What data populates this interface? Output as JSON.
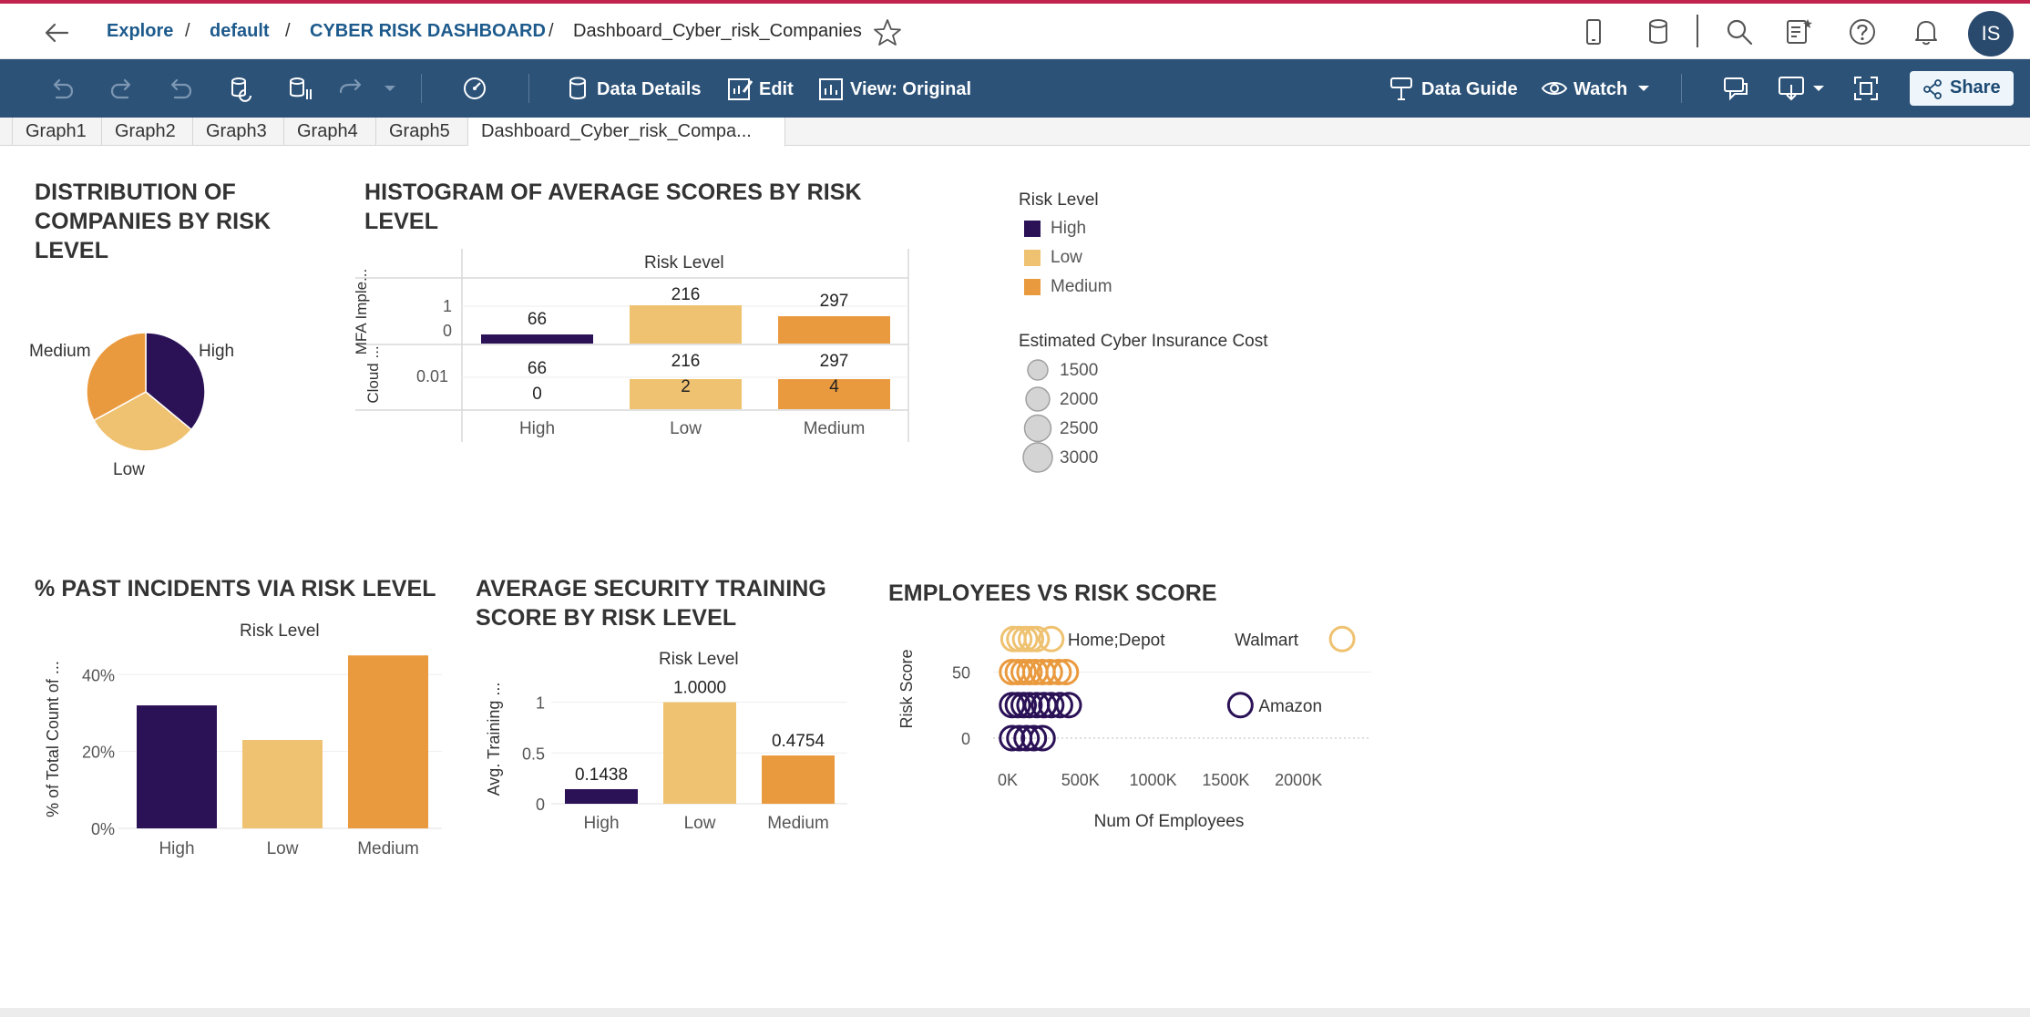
{
  "breadcrumb": {
    "explore": "Explore",
    "project": "default",
    "workbook": "CYBER RISK DASHBOARD",
    "view": "Dashboard_Cyber_risk_Companies",
    "sep": "/"
  },
  "user": {
    "initials": "IS"
  },
  "toolbar": {
    "data_details": "Data Details",
    "edit": "Edit",
    "view_original": "View: Original",
    "data_guide": "Data Guide",
    "watch": "Watch",
    "share": "Share"
  },
  "tabs": [
    "Graph1",
    "Graph2",
    "Graph3",
    "Graph4",
    "Graph5",
    "Dashboard_Cyber_risk_Compa..."
  ],
  "colors": {
    "high": "#2b1257",
    "low": "#efc271",
    "medium": "#ea9a3e",
    "toolbar": "#2c5278",
    "link": "#1d5a8c"
  },
  "pie": {
    "title": "DISTRIBUTION OF COMPANIES BY RISK LEVEL",
    "labels": {
      "medium": "Medium",
      "high": "High",
      "low": "Low"
    }
  },
  "histogram": {
    "title": "HISTOGRAM OF AVERAGE SCORES BY RISK LEVEL",
    "header": "Risk Level",
    "row1_label": "MFA Imple...",
    "row2_label": "Cloud ...",
    "row1_ticks": [
      "1",
      "0"
    ],
    "row2_tick": "0.01",
    "row1_values": [
      "66",
      "216",
      "297"
    ],
    "row2_top_values": [
      "66",
      "216",
      "297"
    ],
    "row2_bar_values": [
      "0",
      "2",
      "4"
    ],
    "categories": [
      "High",
      "Low",
      "Medium"
    ]
  },
  "legend": {
    "risk_title": "Risk Level",
    "risk_items": [
      "High",
      "Low",
      "Medium"
    ],
    "cost_title": "Estimated Cyber Insurance Cost",
    "cost_items": [
      "1500",
      "2000",
      "2500",
      "3000"
    ]
  },
  "chart_data": [
    {
      "type": "pie",
      "title": "DISTRIBUTION OF COMPANIES BY RISK LEVEL",
      "categories": [
        "High",
        "Low",
        "Medium"
      ],
      "values": [
        0.36,
        0.31,
        0.33
      ]
    },
    {
      "type": "bar",
      "title": "HISTOGRAM OF AVERAGE SCORES BY RISK LEVEL",
      "categories": [
        "High",
        "Low",
        "Medium"
      ],
      "series": [
        {
          "name": "MFA Imple...",
          "values": [
            66,
            216,
            297
          ]
        },
        {
          "name": "Cloud ...",
          "values": [
            0,
            2,
            4
          ]
        }
      ]
    },
    {
      "type": "bar",
      "title": "% PAST INCIDENTS VIA RISK LEVEL",
      "header": "Risk Level",
      "ylabel": "% of Total Count of ...",
      "categories": [
        "High",
        "Low",
        "Medium"
      ],
      "values": [
        32,
        23,
        45
      ],
      "yticks": [
        "40%",
        "20%",
        "0%"
      ],
      "ylim": [
        0,
        46
      ]
    },
    {
      "type": "bar",
      "title": "AVERAGE SECURITY TRAINING SCORE BY RISK LEVEL",
      "header": "Risk Level",
      "ylabel": "Avg. Training ...",
      "categories": [
        "High",
        "Low",
        "Medium"
      ],
      "values": [
        0.1438,
        1.0,
        0.4754
      ],
      "labels": [
        "0.1438",
        "1.0000",
        "0.4754"
      ],
      "yticks": [
        "1",
        "0.5",
        "0"
      ],
      "ylim": [
        0,
        1.05
      ]
    },
    {
      "type": "scatter",
      "title": "EMPLOYEES VS RISK SCORE",
      "xlabel": "Num Of Employees",
      "ylabel": "Risk Score",
      "xticks": [
        "0K",
        "500K",
        "1000K",
        "1500K",
        "2000K"
      ],
      "yticks": [
        "50",
        "0"
      ],
      "annotations": [
        "Home;Depot",
        "Walmart",
        "Amazon"
      ],
      "points": [
        {
          "x": 300000,
          "y": 75,
          "level": "Low",
          "label": "Home;Depot"
        },
        {
          "x": 2300000,
          "y": 75,
          "level": "Low",
          "label": "Walmart"
        },
        {
          "x": 1600000,
          "y": 25,
          "level": "High",
          "label": "Amazon"
        },
        {
          "x": 40000,
          "y": 75,
          "level": "Low"
        },
        {
          "x": 80000,
          "y": 75,
          "level": "Low"
        },
        {
          "x": 120000,
          "y": 75,
          "level": "Low"
        },
        {
          "x": 160000,
          "y": 75,
          "level": "Low"
        },
        {
          "x": 200000,
          "y": 75,
          "level": "Low"
        },
        {
          "x": 30000,
          "y": 50,
          "level": "Medium"
        },
        {
          "x": 70000,
          "y": 50,
          "level": "Medium"
        },
        {
          "x": 110000,
          "y": 50,
          "level": "Medium"
        },
        {
          "x": 150000,
          "y": 50,
          "level": "Medium"
        },
        {
          "x": 190000,
          "y": 50,
          "level": "Medium"
        },
        {
          "x": 240000,
          "y": 50,
          "level": "Medium"
        },
        {
          "x": 290000,
          "y": 50,
          "level": "Medium"
        },
        {
          "x": 350000,
          "y": 50,
          "level": "Medium"
        },
        {
          "x": 400000,
          "y": 50,
          "level": "Medium"
        },
        {
          "x": 30000,
          "y": 25,
          "level": "High"
        },
        {
          "x": 70000,
          "y": 25,
          "level": "High"
        },
        {
          "x": 110000,
          "y": 25,
          "level": "High"
        },
        {
          "x": 150000,
          "y": 25,
          "level": "High"
        },
        {
          "x": 200000,
          "y": 25,
          "level": "High"
        },
        {
          "x": 250000,
          "y": 25,
          "level": "High"
        },
        {
          "x": 300000,
          "y": 25,
          "level": "High"
        },
        {
          "x": 360000,
          "y": 25,
          "level": "High"
        },
        {
          "x": 420000,
          "y": 25,
          "level": "High"
        },
        {
          "x": 30000,
          "y": 0,
          "level": "High"
        },
        {
          "x": 80000,
          "y": 0,
          "level": "High"
        },
        {
          "x": 130000,
          "y": 0,
          "level": "High"
        },
        {
          "x": 180000,
          "y": 0,
          "level": "High"
        },
        {
          "x": 240000,
          "y": 0,
          "level": "High"
        }
      ]
    }
  ]
}
